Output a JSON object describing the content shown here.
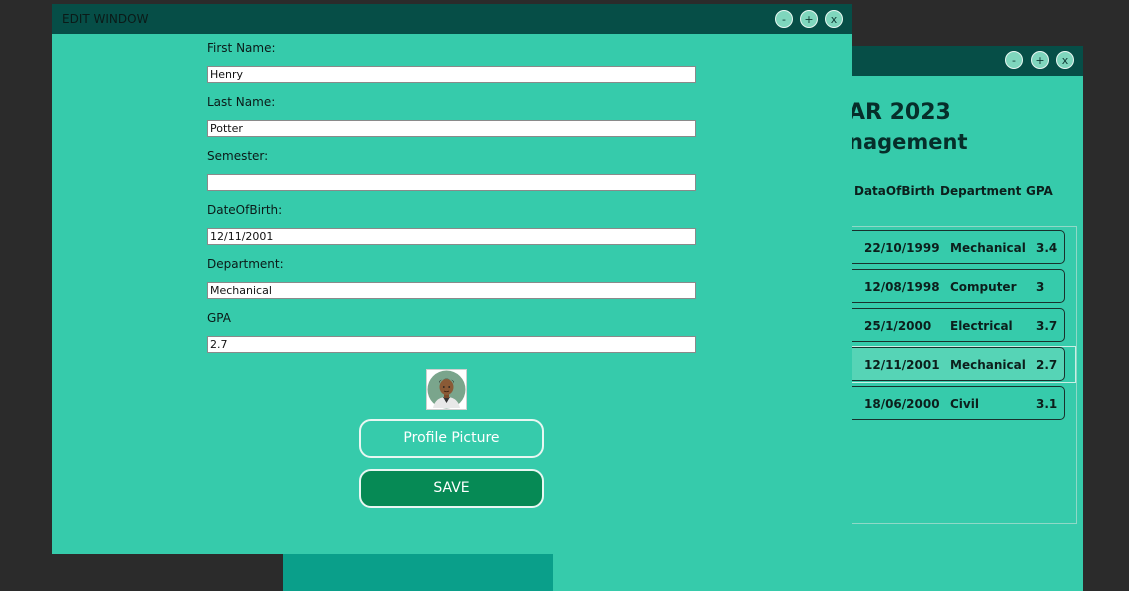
{
  "background_window": {
    "heading_line1": "AR 2023",
    "heading_line2": "nagement",
    "columns": [
      "DataOfBirth",
      "Department",
      "GPA"
    ],
    "rows": [
      {
        "dob": "22/10/1999",
        "department": "Mechanical",
        "gpa": "3.4"
      },
      {
        "dob": "12/08/1998",
        "department": "Computer",
        "gpa": "3"
      },
      {
        "dob": "25/1/2000",
        "department": "Electrical",
        "gpa": "3.7"
      },
      {
        "dob": "12/11/2001",
        "department": "Mechanical",
        "gpa": "2.7"
      },
      {
        "dob": "18/06/2000",
        "department": "Civil",
        "gpa": "3.1"
      }
    ],
    "selected_row": 3,
    "controls": {
      "minimize": "-",
      "maximize": "+",
      "close": "x"
    }
  },
  "edit_window": {
    "title": "EDIT WINDOW",
    "controls": {
      "minimize": "-",
      "maximize": "+",
      "close": "x"
    },
    "fields": {
      "first_name": {
        "label": "First Name:",
        "value": "Henry"
      },
      "last_name": {
        "label": "Last Name:",
        "value": "Potter"
      },
      "semester": {
        "label": "Semester:",
        "value": ""
      },
      "date_of_birth": {
        "label": "DateOfBirth:",
        "value": "12/11/2001"
      },
      "department": {
        "label": "Department:",
        "value": "Mechanical"
      },
      "gpa": {
        "label": "GPA",
        "value": "2.7"
      }
    },
    "profile_picture_button": "Profile Picture",
    "save_button": "SAVE"
  },
  "colors": {
    "window_bg": "#36cbab",
    "titlebar": "#064e47",
    "save_button": "#068a55",
    "desktop": "#2b2b2b"
  }
}
